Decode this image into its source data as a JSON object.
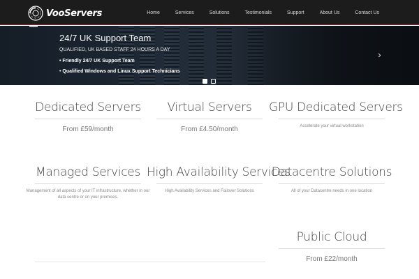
{
  "brand": {
    "name": "VooServers",
    "logo_icon": "vooservers-logo-icon"
  },
  "nav": {
    "items": [
      {
        "label": "Home"
      },
      {
        "label": "Services"
      },
      {
        "label": "Solutions"
      },
      {
        "label": "Testimonials"
      },
      {
        "label": "Support"
      },
      {
        "label": "About Us"
      },
      {
        "label": "Contact Us"
      }
    ]
  },
  "hero": {
    "title": "24/7 UK Support Team",
    "subtitle": "QUALIFIED, UK BASED STAFF 24 HOURS A DAY",
    "bullets": [
      "• Friendly 24/7 UK Support Team",
      "• Qualified Windows and Linux Support Technicians"
    ],
    "slides_total": 2,
    "active_slide": 1,
    "next_icon": "chevron-right-icon"
  },
  "services": [
    {
      "title": "Dedicated Servers",
      "price": "From £59/month",
      "desc": ""
    },
    {
      "title": "Virtual Servers",
      "price": "From £4.50/month",
      "desc": ""
    },
    {
      "title": "GPU Dedicated Servers",
      "price": "",
      "desc": "Accelerate your virtual workstation"
    },
    {
      "title": "Managed Services",
      "price": "",
      "desc": "Management of all aspects of your IT infrastructure, whether in our data centre or on your premises."
    },
    {
      "title": "High Availability Services",
      "price": "",
      "desc": "High Availability Services and Failover Solutions"
    },
    {
      "title": "Datacentre Solutions",
      "price": "",
      "desc": "All of your Datacentre needs in one location"
    },
    {
      "title": "Public Cloud",
      "price": "From £22/month",
      "desc": ""
    }
  ],
  "colors": {
    "nav_bg": "#1c1c1c",
    "nav_accent_line": "#8a2a2a",
    "text": "#444444"
  }
}
